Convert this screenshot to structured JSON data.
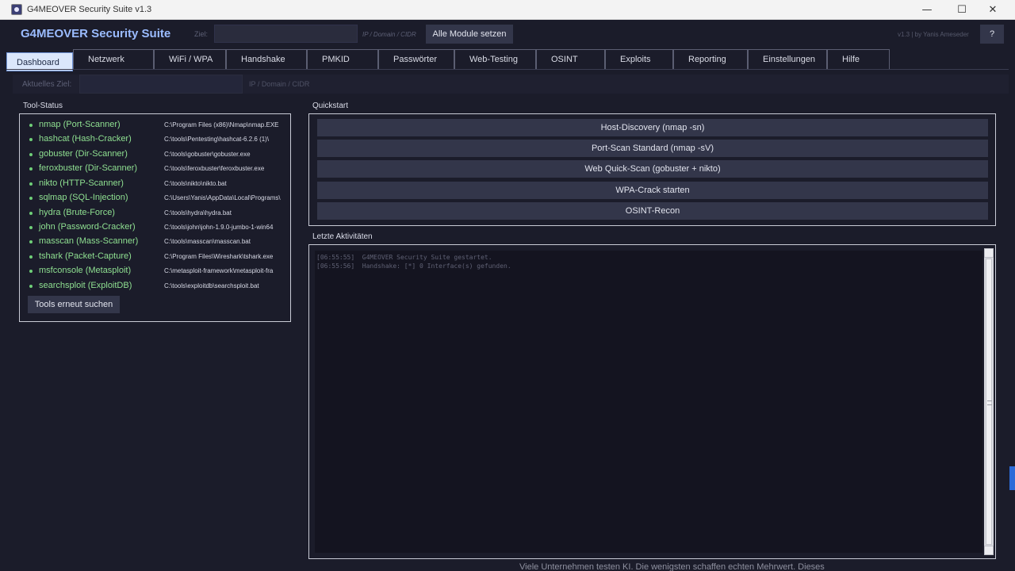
{
  "window": {
    "title": "G4MEOVER Security Suite  v1.3",
    "controls": [
      "—",
      "☐",
      "✕"
    ]
  },
  "header": {
    "app_title": "G4MEOVER Security Suite",
    "target_label": "Ziel:",
    "target_value": "",
    "target_hint": "IP / Domain / CIDR",
    "set_all_button": "Alle Module setzen",
    "version": "v1.3  |  by Yanis Ameseder",
    "help_button": "?"
  },
  "tabs": [
    {
      "label": "Dashboard",
      "active": true
    },
    {
      "label": "Netzwerk"
    },
    {
      "label": "WiFi / WPA"
    },
    {
      "label": "Handshake"
    },
    {
      "label": "PMKID"
    },
    {
      "label": "Passwörter"
    },
    {
      "label": "Web-Testing"
    },
    {
      "label": "OSINT"
    },
    {
      "label": "Exploits"
    },
    {
      "label": "Reporting"
    },
    {
      "label": "Einstellungen"
    },
    {
      "label": "Hilfe"
    }
  ],
  "target_row": {
    "label": "Aktuelles Ziel:",
    "value": "",
    "hint": "IP / Domain / CIDR"
  },
  "tool_status": {
    "title": "Tool-Status",
    "tools": [
      {
        "name": "nmap  (Port-Scanner)",
        "path": "C:\\Program Files (x86)\\Nmap\\nmap.EXE"
      },
      {
        "name": "hashcat  (Hash-Cracker)",
        "path": "C:\\tools\\Pentesting\\hashcat-6.2.6 (1)\\"
      },
      {
        "name": "gobuster  (Dir-Scanner)",
        "path": "C:\\tools\\gobuster\\gobuster.exe"
      },
      {
        "name": "feroxbuster  (Dir-Scanner)",
        "path": "C:\\tools\\feroxbuster\\feroxbuster.exe"
      },
      {
        "name": "nikto  (HTTP-Scanner)",
        "path": "C:\\tools\\nikto\\nikto.bat"
      },
      {
        "name": "sqlmap  (SQL-Injection)",
        "path": "C:\\Users\\Yanis\\AppData\\Local\\Programs\\"
      },
      {
        "name": "hydra  (Brute-Force)",
        "path": "C:\\tools\\hydra\\hydra.bat"
      },
      {
        "name": "john  (Password-Cracker)",
        "path": "C:\\tools\\john\\john-1.9.0-jumbo-1-win64"
      },
      {
        "name": "masscan  (Mass-Scanner)",
        "path": "C:\\tools\\masscan\\masscan.bat"
      },
      {
        "name": "tshark  (Packet-Capture)",
        "path": "C:\\Program Files\\Wireshark\\tshark.exe"
      },
      {
        "name": "msfconsole  (Metasploit)",
        "path": "C:\\metasploit-framework\\metasploit-fra"
      },
      {
        "name": "searchsploit  (ExploitDB)",
        "path": "C:\\tools\\exploitdb\\searchsploit.bat"
      }
    ],
    "rescan_button": "Tools erneut suchen",
    "status_color": "#6fcf78"
  },
  "quickstart": {
    "title": "Quickstart",
    "buttons": [
      "Host-Discovery  (nmap -sn)",
      "Port-Scan Standard  (nmap -sV)",
      "Web Quick-Scan  (gobuster + nikto)",
      "WPA-Crack starten",
      "OSINT-Recon"
    ]
  },
  "activity": {
    "title": "Letzte Aktivitäten",
    "lines": [
      "[06:55:55]  G4MEOVER Security Suite gestartet.",
      "[06:55:56]  Handshake: [*] 0 Interface(s) gefunden."
    ]
  },
  "background": {
    "text": "Viele Unternehmen testen KI. Die wenigsten schaffen echten Mehrwert. Dieses"
  },
  "colors": {
    "background": "#1b1c2a",
    "accent": "#9bbcff",
    "active_tab": "#dbe7fb",
    "button": "#33364a"
  }
}
